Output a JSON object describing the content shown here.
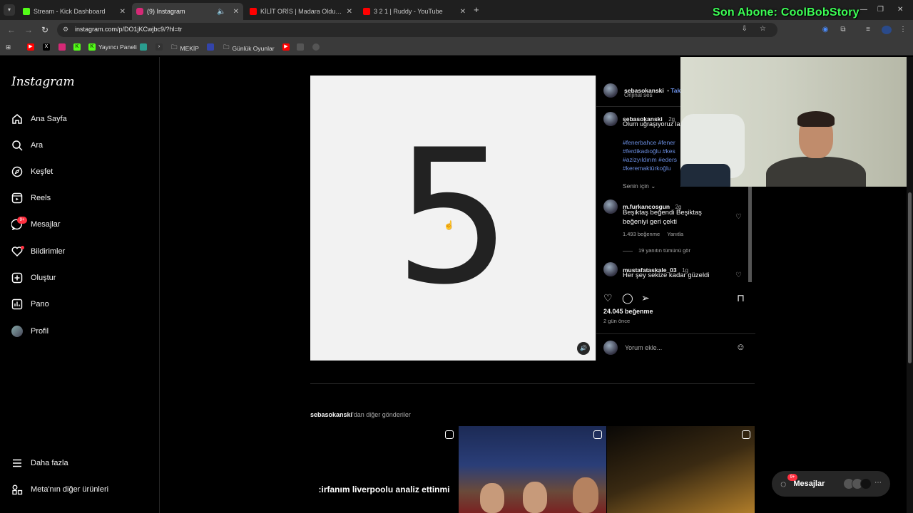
{
  "browser": {
    "tabs": [
      {
        "title": "Stream - Kick Dashboard",
        "favicon_color": "#53fc18"
      },
      {
        "title": "(9) Instagram",
        "favicon_color": "#d62976"
      },
      {
        "title": "KİLİT ORİS | Madara Olduk #57",
        "favicon_color": "#ff0000"
      },
      {
        "title": "3 2 1 | Ruddy - YouTube",
        "favicon_color": "#ff0000"
      }
    ],
    "url": "instagram.com/p/DO1jKCwjbc9/?hl=tr",
    "bookmarks": [
      "Yayıncı Paneli",
      "MEKİP",
      "Günlük Oyunlar"
    ]
  },
  "overlay": {
    "text": "Son Abone: CoolBobStory",
    "color": "#3cff55"
  },
  "sidebar": {
    "logo": "Instagram",
    "items": [
      {
        "label": "Ana Sayfa",
        "icon": "home-icon"
      },
      {
        "label": "Ara",
        "icon": "search-icon"
      },
      {
        "label": "Keşfet",
        "icon": "compass-icon"
      },
      {
        "label": "Reels",
        "icon": "reels-icon"
      },
      {
        "label": "Mesajlar",
        "icon": "messenger-icon",
        "badge": "9+"
      },
      {
        "label": "Bildirimler",
        "icon": "heart-icon"
      },
      {
        "label": "Oluştur",
        "icon": "plus-square-icon"
      },
      {
        "label": "Pano",
        "icon": "chart-icon"
      },
      {
        "label": "Profil",
        "icon": "avatar-icon"
      }
    ],
    "more": "Daha fazla",
    "meta": "Meta'nın diğer ürünleri"
  },
  "post": {
    "media_text": "5",
    "author": "sebasokanski",
    "follow": "Tak",
    "audio": "Orijinal ses",
    "caption_user": "sebasokanski",
    "caption_time": "2g",
    "caption": "Olum uğraşıyoruz la",
    "hashtags": [
      "#fenerbahce #fener",
      "#ferdikadıoğlu #kes",
      "#azizyıldırım #eders",
      "#keremaktürkoğlu"
    ],
    "for_you": "Senin için",
    "comments": [
      {
        "user": "m.furkancosgun",
        "time": "2g",
        "text": "Beşiktaş beğendi Beşiktaş beğeniyi geri çekti",
        "likes": "1.493 beğenme",
        "reply": "Yanıtla",
        "replies": "19 yanıtın tümünü gör"
      },
      {
        "user": "mustafataskale_03",
        "time": "1g",
        "text": "Her şey sekize kadar güzeldi"
      }
    ],
    "like_count": "24.045 beğenme",
    "posted": "2 gün önce",
    "comment_placeholder": "Yorum ekle..."
  },
  "more_posts": {
    "user": "sebasokanski",
    "suffix": "'dan diğer gönderiler",
    "thumb1_caption": ":irfanım liverpoolu analiz ettinmi"
  },
  "messages_pill": {
    "label": "Mesajlar",
    "badge": "9+"
  }
}
